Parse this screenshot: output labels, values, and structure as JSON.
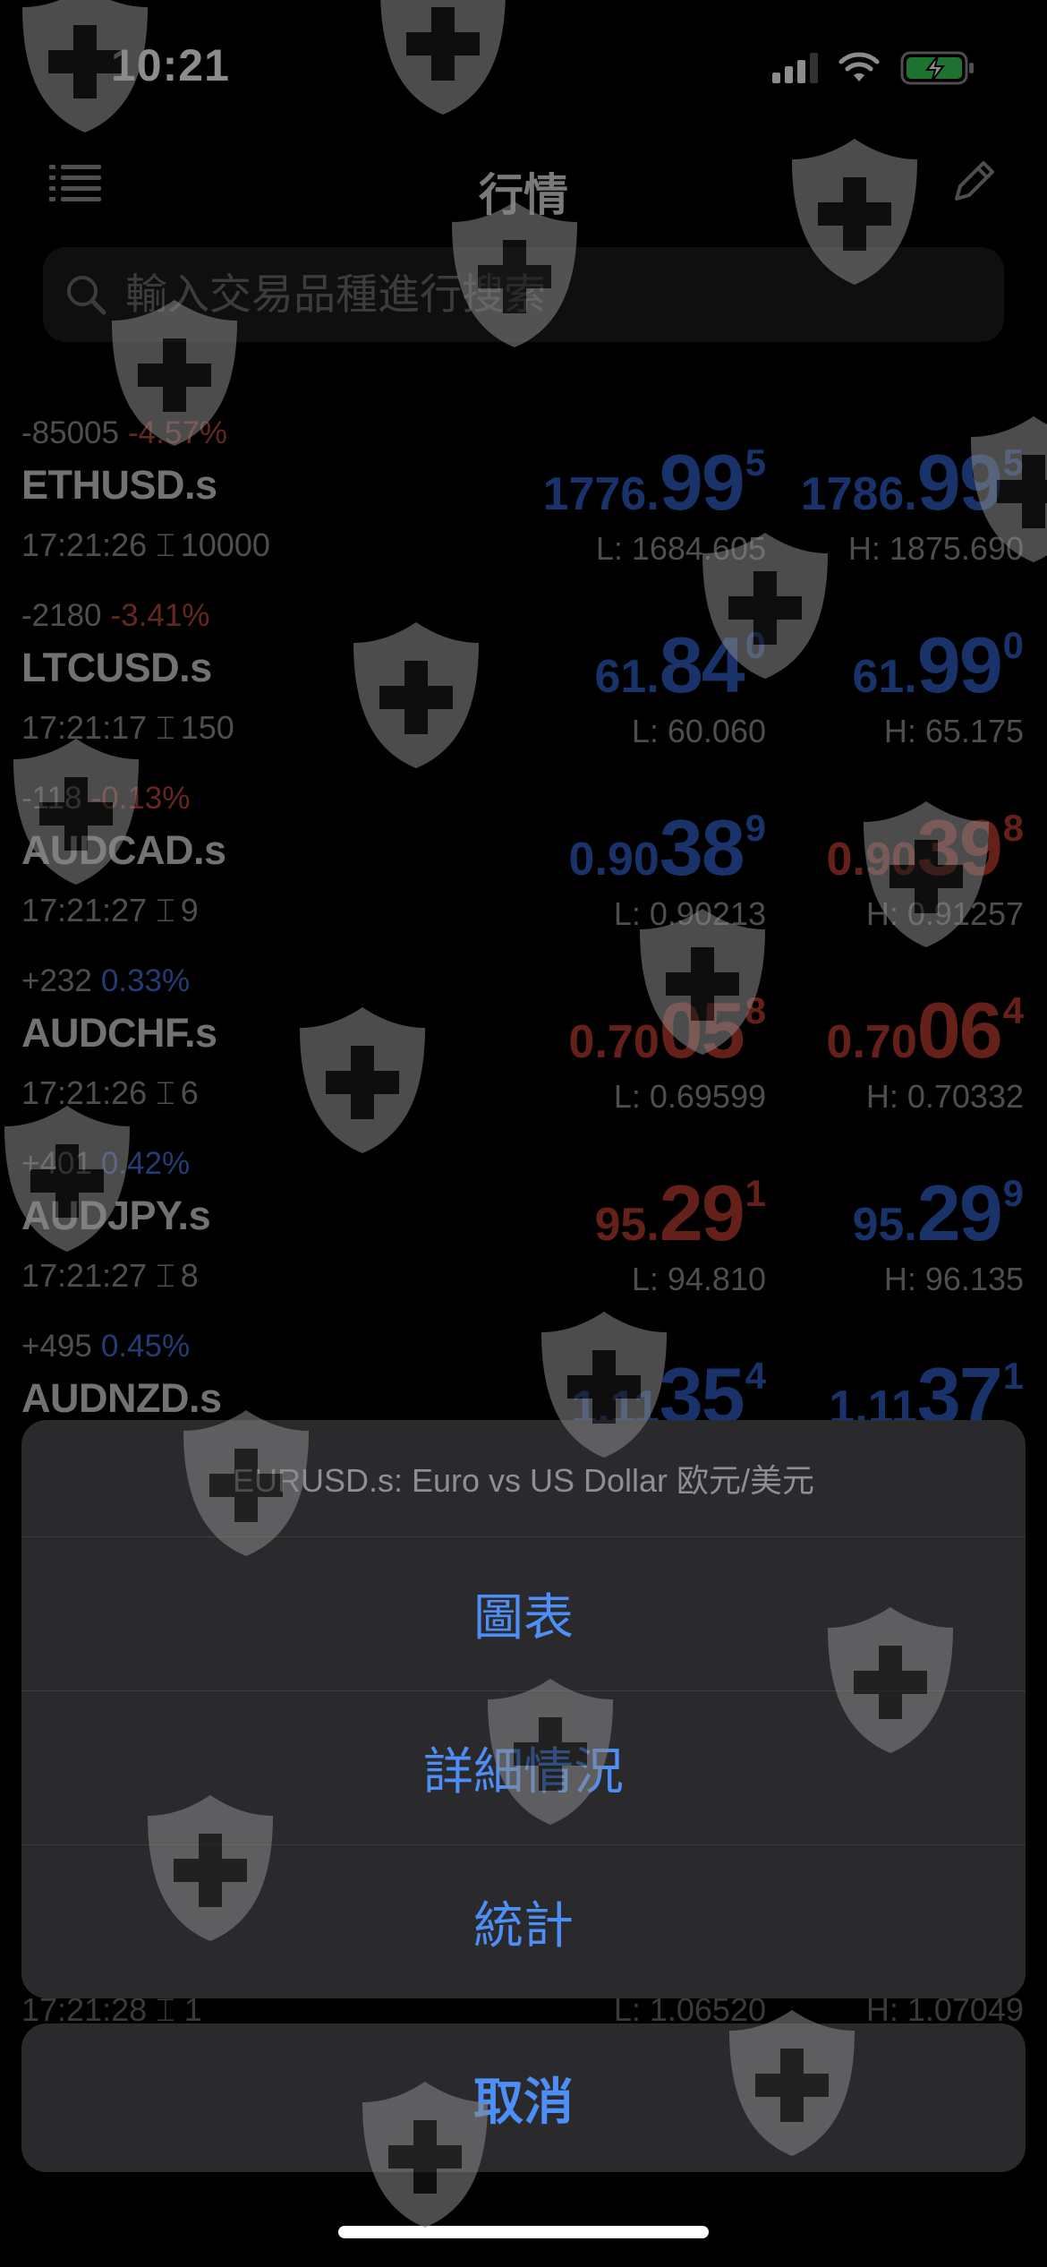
{
  "status_bar": {
    "time": "10:21"
  },
  "navbar": {
    "title": "行情"
  },
  "search": {
    "placeholder": "輸入交易品種進行搜索"
  },
  "quotes": [
    {
      "change": "-85005",
      "percent": "-4.57%",
      "direction": "down",
      "symbol": "ETHUSD.s",
      "time": "17:21:26",
      "spread": "10000",
      "bid": {
        "small": "1776.",
        "big": "99",
        "sup": "5",
        "color": "blue"
      },
      "ask": {
        "small": "1786.",
        "big": "99",
        "sup": "5",
        "color": "blue"
      },
      "low": "1684.605",
      "high": "1875.690"
    },
    {
      "change": "-2180",
      "percent": "-3.41%",
      "direction": "down",
      "symbol": "LTCUSD.s",
      "time": "17:21:17",
      "spread": "150",
      "bid": {
        "small": "61.",
        "big": "84",
        "sup": "0",
        "color": "blue"
      },
      "ask": {
        "small": "61.",
        "big": "99",
        "sup": "0",
        "color": "blue"
      },
      "low": "60.060",
      "high": "65.175"
    },
    {
      "change": "-118",
      "percent": "-0.13%",
      "direction": "down",
      "symbol": "AUDCAD.s",
      "time": "17:21:27",
      "spread": "9",
      "bid": {
        "small": "0.90",
        "big": "38",
        "sup": "9",
        "color": "blue"
      },
      "ask": {
        "small": "0.90",
        "big": "39",
        "sup": "8",
        "color": "red"
      },
      "low": "0.90213",
      "high": "0.91257"
    },
    {
      "change": "+232",
      "percent": "0.33%",
      "direction": "up",
      "symbol": "AUDCHF.s",
      "time": "17:21:26",
      "spread": "6",
      "bid": {
        "small": "0.70",
        "big": "05",
        "sup": "8",
        "color": "red"
      },
      "ask": {
        "small": "0.70",
        "big": "06",
        "sup": "4",
        "color": "red"
      },
      "low": "0.69599",
      "high": "0.70332"
    },
    {
      "change": "+401",
      "percent": "0.42%",
      "direction": "up",
      "symbol": "AUDJPY.s",
      "time": "17:21:27",
      "spread": "8",
      "bid": {
        "small": "95.",
        "big": "29",
        "sup": "1",
        "color": "red"
      },
      "ask": {
        "small": "95.",
        "big": "29",
        "sup": "9",
        "color": "blue"
      },
      "low": "94.810",
      "high": "96.135"
    },
    {
      "change": "+495",
      "percent": "0.45%",
      "direction": "up",
      "symbol": "AUDNZD.s",
      "time": "",
      "spread": "",
      "bid": {
        "small": "1.11",
        "big": "35",
        "sup": "4",
        "color": "blue"
      },
      "ask": {
        "small": "1.11",
        "big": "37",
        "sup": "1",
        "color": "blue"
      },
      "low": "",
      "high": ""
    }
  ],
  "partial_row": {
    "time": "17:21:28",
    "spread": "1",
    "low": "1.06520",
    "high": "1.07049"
  },
  "labels": {
    "low_prefix": "L:",
    "high_prefix": "H:"
  },
  "action_sheet": {
    "title": "EURUSD.s: Euro vs US Dollar 欧元/美元",
    "actions": [
      "圖表",
      "詳細情況",
      "統計"
    ],
    "cancel": "取消"
  },
  "colors": {
    "blue": "#2e5bbf",
    "red": "#b83d2e",
    "action": "#4e8ef7",
    "sheet_bg": "#2a2a2d"
  },
  "icons": [
    "list-icon",
    "edit-icon",
    "search-icon",
    "signal-icon",
    "wifi-icon",
    "battery-charging-icon",
    "shield-plus-watermark-icon"
  ]
}
